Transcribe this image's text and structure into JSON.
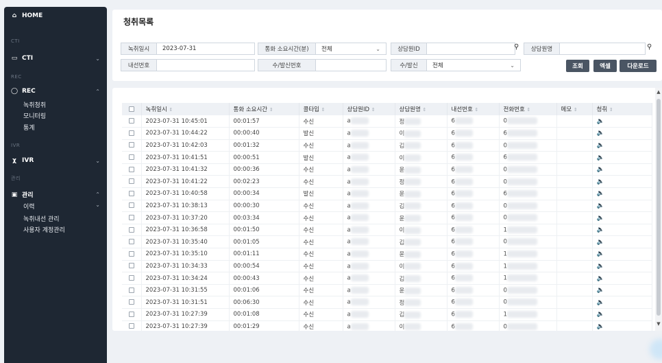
{
  "sidebar": {
    "home": "HOME",
    "sections": {
      "cti": "CTI",
      "rec": "REC",
      "ivr": "IVR",
      "admin": "관리"
    },
    "cti_label": "CTI",
    "rec_label": "REC",
    "rec_children": [
      "녹취청취",
      "모니터링",
      "통계"
    ],
    "ivr_label": "IVR",
    "admin_label": "관리",
    "admin_children": [
      "이력",
      "녹취내선 관리",
      "사용자 계정관리"
    ]
  },
  "page": {
    "title": "청취목록"
  },
  "filters": {
    "date_label": "녹취일시",
    "date_value": "2023-07-31",
    "duration_label": "통화 소요시간(분)",
    "duration_value": "전체",
    "agent_id_label": "상담원ID",
    "agent_id_value": "",
    "agent_name_label": "상담원명",
    "agent_name_value": "",
    "extension_label": "내선번호",
    "extension_value": "",
    "caller_label": "수/발신번호",
    "caller_value": "",
    "direction_label": "수/발신",
    "direction_value": "전체"
  },
  "buttons": {
    "search": "조회",
    "excel": "엑셀",
    "download": "다운로드"
  },
  "table": {
    "columns": [
      "녹취일시",
      "통화 소요시간",
      "콜타입",
      "상담원ID",
      "상담원명",
      "내선번호",
      "전화번호",
      "메모",
      "청취"
    ],
    "rows": [
      {
        "datetime": "2023-07-31 10:45:01",
        "duration": "00:01:57",
        "type": "수신",
        "agent_id": "a",
        "agent_name": "정",
        "ext": "6",
        "phone": "0"
      },
      {
        "datetime": "2023-07-31 10:44:22",
        "duration": "00:00:40",
        "type": "발신",
        "agent_id": "a",
        "agent_name": "이",
        "ext": "6",
        "phone": "6"
      },
      {
        "datetime": "2023-07-31 10:42:03",
        "duration": "00:01:32",
        "type": "수신",
        "agent_id": "a",
        "agent_name": "김",
        "ext": "6",
        "phone": "0"
      },
      {
        "datetime": "2023-07-31 10:41:51",
        "duration": "00:00:51",
        "type": "발신",
        "agent_id": "a",
        "agent_name": "이",
        "ext": "6",
        "phone": "6"
      },
      {
        "datetime": "2023-07-31 10:41:32",
        "duration": "00:00:36",
        "type": "수신",
        "agent_id": "a",
        "agent_name": "윤",
        "ext": "6",
        "phone": "0"
      },
      {
        "datetime": "2023-07-31 10:41:22",
        "duration": "00:02:23",
        "type": "수신",
        "agent_id": "a",
        "agent_name": "정",
        "ext": "6",
        "phone": "0"
      },
      {
        "datetime": "2023-07-31 10:40:58",
        "duration": "00:00:34",
        "type": "발신",
        "agent_id": "a",
        "agent_name": "윤",
        "ext": "6",
        "phone": "6"
      },
      {
        "datetime": "2023-07-31 10:38:13",
        "duration": "00:00:30",
        "type": "수신",
        "agent_id": "a",
        "agent_name": "김",
        "ext": "6",
        "phone": "0"
      },
      {
        "datetime": "2023-07-31 10:37:20",
        "duration": "00:03:34",
        "type": "수신",
        "agent_id": "a",
        "agent_name": "윤",
        "ext": "6",
        "phone": "0"
      },
      {
        "datetime": "2023-07-31 10:36:58",
        "duration": "00:01:50",
        "type": "수신",
        "agent_id": "a",
        "agent_name": "이",
        "ext": "6",
        "phone": "1"
      },
      {
        "datetime": "2023-07-31 10:35:40",
        "duration": "00:01:05",
        "type": "수신",
        "agent_id": "a",
        "agent_name": "김",
        "ext": "6",
        "phone": "0"
      },
      {
        "datetime": "2023-07-31 10:35:10",
        "duration": "00:01:11",
        "type": "수신",
        "agent_id": "a",
        "agent_name": "윤",
        "ext": "6",
        "phone": "1"
      },
      {
        "datetime": "2023-07-31 10:34:33",
        "duration": "00:00:54",
        "type": "수신",
        "agent_id": "a",
        "agent_name": "이",
        "ext": "6",
        "phone": "1"
      },
      {
        "datetime": "2023-07-31 10:34:24",
        "duration": "00:00:43",
        "type": "수신",
        "agent_id": "a",
        "agent_name": "김",
        "ext": "6",
        "phone": "1"
      },
      {
        "datetime": "2023-07-31 10:31:55",
        "duration": "00:01:06",
        "type": "수신",
        "agent_id": "a",
        "agent_name": "윤",
        "ext": "6",
        "phone": "0"
      },
      {
        "datetime": "2023-07-31 10:31:51",
        "duration": "00:06:30",
        "type": "수신",
        "agent_id": "a",
        "agent_name": "정",
        "ext": "6",
        "phone": "0"
      },
      {
        "datetime": "2023-07-31 10:27:39",
        "duration": "00:01:08",
        "type": "수신",
        "agent_id": "a",
        "agent_name": "김",
        "ext": "6",
        "phone": "1"
      },
      {
        "datetime": "2023-07-31 10:27:39",
        "duration": "00:01:29",
        "type": "수신",
        "agent_id": "a",
        "agent_name": "이",
        "ext": "6",
        "phone": "0"
      }
    ]
  }
}
